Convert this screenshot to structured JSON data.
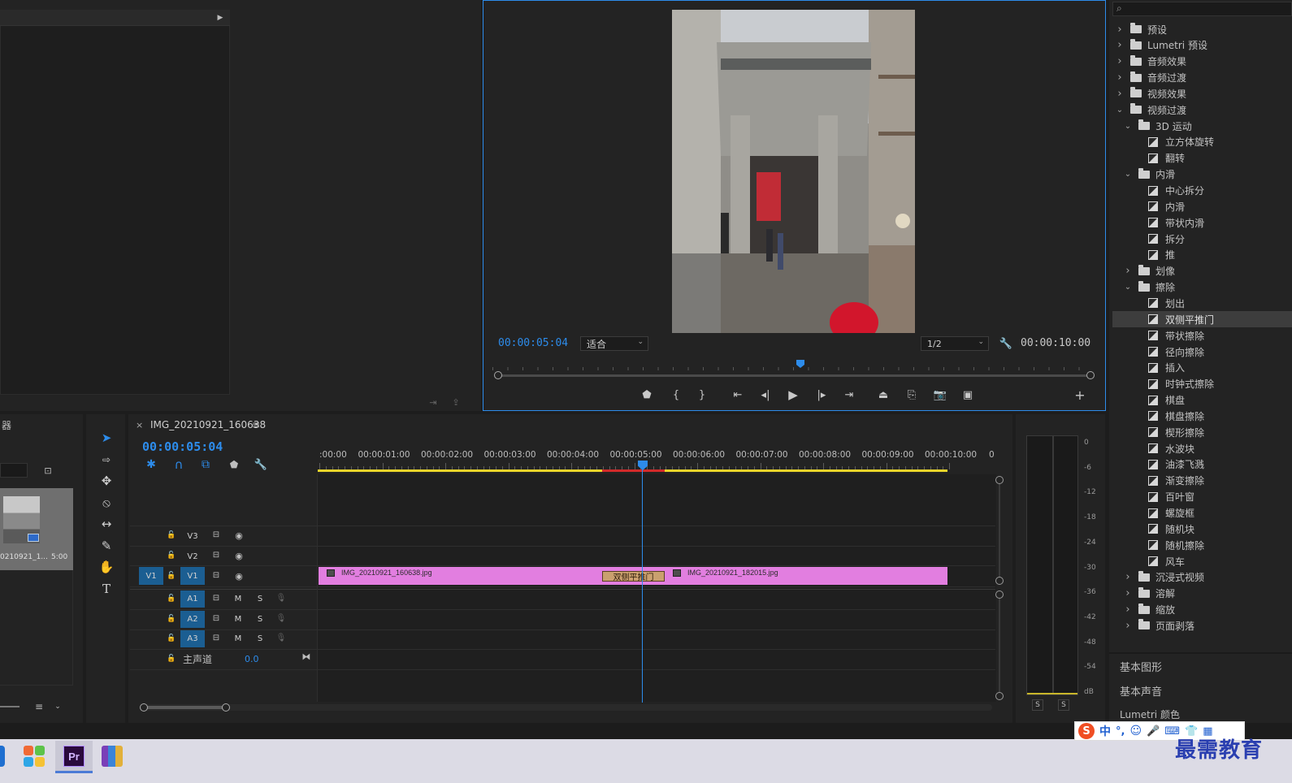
{
  "program_monitor": {
    "current_time": "00:00:05:04",
    "fit_label": "适合",
    "resolution": "1/2",
    "duration": "00:00:10:00"
  },
  "project_panel": {
    "title_fragment": "器",
    "thumb_name": "0210921_1...",
    "thumb_duration": "5:00"
  },
  "timeline": {
    "close_label": "×",
    "sequence_name": "IMG_20210921_160638",
    "current_time": "00:00:05:04",
    "ruler": [
      ":00:00",
      "00:00:01:00",
      "00:00:02:00",
      "00:00:03:00",
      "00:00:04:00",
      "00:00:05:00",
      "00:00:06:00",
      "00:00:07:00",
      "00:00:08:00",
      "00:00:09:00",
      "00:00:10:00",
      "0"
    ],
    "tracks": {
      "v3": "V3",
      "v2": "V2",
      "v1_src": "V1",
      "v1": "V1",
      "a1": "A1",
      "a2": "A2",
      "a3": "A3",
      "m": "M",
      "s": "S"
    },
    "master_label": "主声道",
    "master_value": "0.0",
    "clip1_name": "IMG_20210921_160638.jpg",
    "clip2_name": "IMG_20210921_182015.jpg",
    "transition_name": "双侧平推门"
  },
  "audio_meter": {
    "scale": [
      "0",
      "-6",
      "-12",
      "-18",
      "-24",
      "-30",
      "-36",
      "-42",
      "-48",
      "-54",
      "dB"
    ],
    "solo_left": "S",
    "solo_right": "S"
  },
  "effects_panel": {
    "items": [
      {
        "label": "预设",
        "kind": "folder-star",
        "level": 0,
        "expanded": false
      },
      {
        "label": "Lumetri 预设",
        "kind": "folder-star",
        "level": 0,
        "expanded": false
      },
      {
        "label": "音频效果",
        "kind": "folder",
        "level": 0,
        "expanded": false
      },
      {
        "label": "音频过渡",
        "kind": "folder",
        "level": 0,
        "expanded": false
      },
      {
        "label": "视频效果",
        "kind": "folder",
        "level": 0,
        "expanded": false
      },
      {
        "label": "视频过渡",
        "kind": "folder",
        "level": 0,
        "expanded": true
      },
      {
        "label": "3D 运动",
        "kind": "folder",
        "level": 1,
        "expanded": true
      },
      {
        "label": "立方体旋转",
        "kind": "fx",
        "level": 2
      },
      {
        "label": "翻转",
        "kind": "fx",
        "level": 2
      },
      {
        "label": "内滑",
        "kind": "folder",
        "level": 1,
        "expanded": true
      },
      {
        "label": "中心拆分",
        "kind": "fx",
        "level": 2
      },
      {
        "label": "内滑",
        "kind": "fx",
        "level": 2
      },
      {
        "label": "带状内滑",
        "kind": "fx",
        "level": 2
      },
      {
        "label": "拆分",
        "kind": "fx",
        "level": 2
      },
      {
        "label": "推",
        "kind": "fx",
        "level": 2
      },
      {
        "label": "划像",
        "kind": "folder",
        "level": 1,
        "expanded": false
      },
      {
        "label": "擦除",
        "kind": "folder",
        "level": 1,
        "expanded": true
      },
      {
        "label": "划出",
        "kind": "fx",
        "level": 2
      },
      {
        "label": "双侧平推门",
        "kind": "fx",
        "level": 2,
        "selected": true
      },
      {
        "label": "带状擦除",
        "kind": "fx",
        "level": 2
      },
      {
        "label": "径向擦除",
        "kind": "fx",
        "level": 2
      },
      {
        "label": "插入",
        "kind": "fx",
        "level": 2
      },
      {
        "label": "时钟式擦除",
        "kind": "fx",
        "level": 2
      },
      {
        "label": "棋盘",
        "kind": "fx",
        "level": 2
      },
      {
        "label": "棋盘擦除",
        "kind": "fx",
        "level": 2
      },
      {
        "label": "楔形擦除",
        "kind": "fx",
        "level": 2
      },
      {
        "label": "水波块",
        "kind": "fx",
        "level": 2
      },
      {
        "label": "油漆飞溅",
        "kind": "fx",
        "level": 2
      },
      {
        "label": "渐变擦除",
        "kind": "fx",
        "level": 2
      },
      {
        "label": "百叶窗",
        "kind": "fx",
        "level": 2
      },
      {
        "label": "螺旋框",
        "kind": "fx",
        "level": 2
      },
      {
        "label": "随机块",
        "kind": "fx",
        "level": 2
      },
      {
        "label": "随机擦除",
        "kind": "fx",
        "level": 2
      },
      {
        "label": "风车",
        "kind": "fx",
        "level": 2
      },
      {
        "label": "沉浸式视频",
        "kind": "folder",
        "level": 1,
        "expanded": false
      },
      {
        "label": "溶解",
        "kind": "folder",
        "level": 1,
        "expanded": false
      },
      {
        "label": "缩放",
        "kind": "folder",
        "level": 1,
        "expanded": false
      },
      {
        "label": "页面剥落",
        "kind": "folder",
        "level": 1,
        "expanded": false
      }
    ],
    "section_graphics": "基本图形",
    "section_sound": "基本声音",
    "section_lumetri": "Lumetri 颜色"
  },
  "taskbar": {
    "premiere_label": "Pr",
    "ime_items": [
      "中",
      "°,"
    ],
    "watermark": "最需教育"
  },
  "colors": {
    "accent_blue": "#2d8ceb",
    "clip_pink": "#e27ee0",
    "transition_tan": "#caa06e",
    "work_area_yellow": "#e8d42a",
    "render_red": "#d22a2a",
    "selected_track": "#1b5e92"
  }
}
